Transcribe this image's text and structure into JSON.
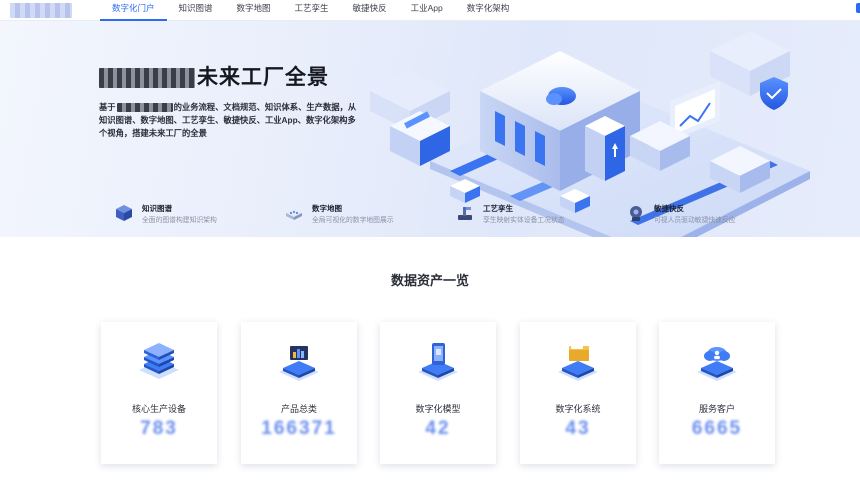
{
  "nav": {
    "tabs": [
      {
        "label": "数字化门户",
        "active": true
      },
      {
        "label": "知识图谱"
      },
      {
        "label": "数字地图"
      },
      {
        "label": "工艺孪生"
      },
      {
        "label": "敏捷快反"
      },
      {
        "label": "工业App"
      },
      {
        "label": "数字化架构"
      }
    ]
  },
  "hero": {
    "title_visible": "未来工厂全景",
    "desc_prefix": "基于",
    "desc_rest": "的业务流程、文档规范、知识体系、生产数据，从知识图谱、数字地图、工艺孪生、敏捷快反、工业App、数字化架构多个视角，搭建未来工厂的全景",
    "features": [
      {
        "title": "知识图谱",
        "desc": "全面的图谱构建知识架构",
        "icon": "cube-icon"
      },
      {
        "title": "数字地图",
        "desc": "全局可视化的数字地图展示",
        "icon": "map-device-icon"
      },
      {
        "title": "工艺孪生",
        "desc": "孪生映射实体设备工况状态",
        "icon": "robot-arm-icon"
      },
      {
        "title": "敏捷快反",
        "desc": "可视人员驱动敏捷快速反应",
        "icon": "gear-head-icon"
      }
    ]
  },
  "assets": {
    "title": "数据资产一览",
    "cards": [
      {
        "label": "核心生产设备",
        "value": "783",
        "icon": "server-stack-icon"
      },
      {
        "label": "产品总类",
        "value": "166371",
        "icon": "chart-monitor-icon"
      },
      {
        "label": "数字化模型",
        "value": "42",
        "icon": "phone-model-icon"
      },
      {
        "label": "数字化系统",
        "value": "43",
        "icon": "folder-system-icon"
      },
      {
        "label": "服务客户",
        "value": "6665",
        "icon": "cloud-users-icon"
      }
    ]
  },
  "colors": {
    "accent": "#2d6cf0",
    "value": "#6b8ff0",
    "hero_bg": "#e6ecfb"
  }
}
